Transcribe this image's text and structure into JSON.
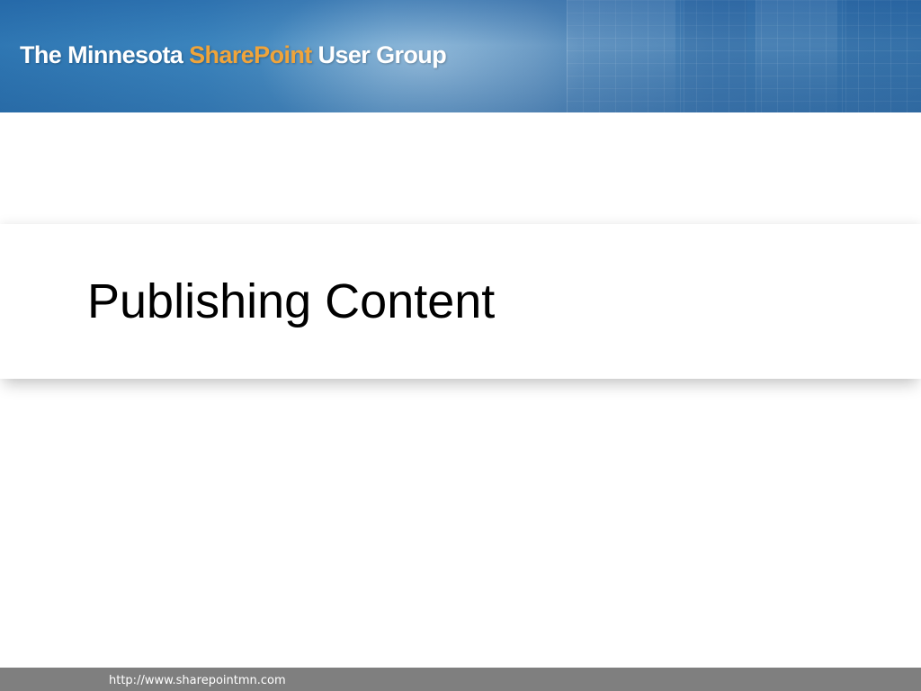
{
  "header": {
    "brand_prefix": "The Minnesota ",
    "brand_accent": "SharePoint",
    "brand_suffix": " User Group",
    "accent_color": "#f0a43a",
    "banner_color": "#3b84bd"
  },
  "slide": {
    "title": "Publishing Content"
  },
  "footer": {
    "url": "http://www.sharepointmn.com",
    "bar_color": "#7f7f7f"
  }
}
